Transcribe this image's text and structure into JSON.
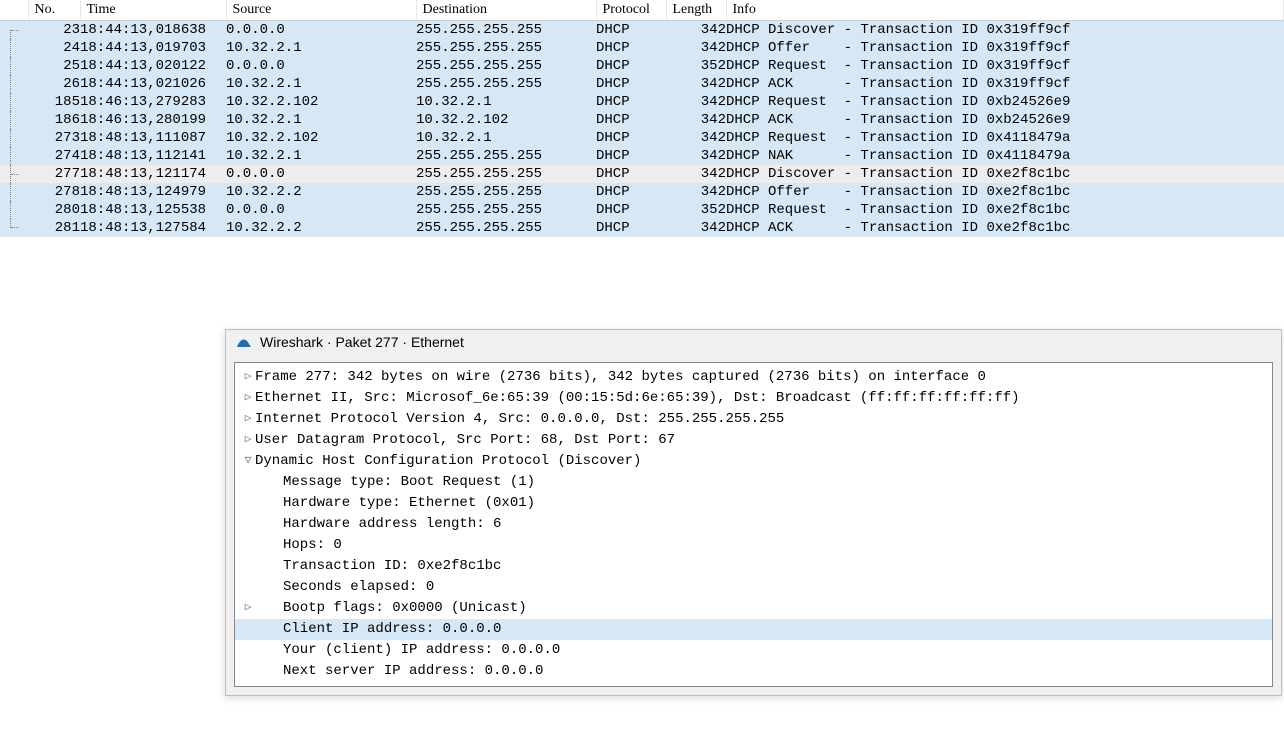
{
  "columns": [
    "No.",
    "Time",
    "Source",
    "Destination",
    "Protocol",
    "Length",
    "Info"
  ],
  "packets": [
    {
      "no": "23",
      "time": "18:44:13,018638",
      "src": "0.0.0.0",
      "dst": "255.255.255.255",
      "proto": "DHCP",
      "len": "342",
      "info": "DHCP Discover - Transaction ID 0x319ff9cf",
      "sel": false,
      "tree": "top"
    },
    {
      "no": "24",
      "time": "18:44:13,019703",
      "src": "10.32.2.1",
      "dst": "255.255.255.255",
      "proto": "DHCP",
      "len": "342",
      "info": "DHCP Offer    - Transaction ID 0x319ff9cf",
      "sel": false,
      "tree": "line"
    },
    {
      "no": "25",
      "time": "18:44:13,020122",
      "src": "0.0.0.0",
      "dst": "255.255.255.255",
      "proto": "DHCP",
      "len": "352",
      "info": "DHCP Request  - Transaction ID 0x319ff9cf",
      "sel": false,
      "tree": "line"
    },
    {
      "no": "26",
      "time": "18:44:13,021026",
      "src": "10.32.2.1",
      "dst": "255.255.255.255",
      "proto": "DHCP",
      "len": "342",
      "info": "DHCP ACK      - Transaction ID 0x319ff9cf",
      "sel": false,
      "tree": "line"
    },
    {
      "no": "185",
      "time": "18:46:13,279283",
      "src": "10.32.2.102",
      "dst": "10.32.2.1",
      "proto": "DHCP",
      "len": "342",
      "info": "DHCP Request  - Transaction ID 0xb24526e9",
      "sel": false,
      "tree": "line"
    },
    {
      "no": "186",
      "time": "18:46:13,280199",
      "src": "10.32.2.1",
      "dst": "10.32.2.102",
      "proto": "DHCP",
      "len": "342",
      "info": "DHCP ACK      - Transaction ID 0xb24526e9",
      "sel": false,
      "tree": "line"
    },
    {
      "no": "273",
      "time": "18:48:13,111087",
      "src": "10.32.2.102",
      "dst": "10.32.2.1",
      "proto": "DHCP",
      "len": "342",
      "info": "DHCP Request  - Transaction ID 0x4118479a",
      "sel": false,
      "tree": "line"
    },
    {
      "no": "274",
      "time": "18:48:13,112141",
      "src": "10.32.2.1",
      "dst": "255.255.255.255",
      "proto": "DHCP",
      "len": "342",
      "info": "DHCP NAK      - Transaction ID 0x4118479a",
      "sel": false,
      "tree": "line"
    },
    {
      "no": "277",
      "time": "18:48:13,121174",
      "src": "0.0.0.0",
      "dst": "255.255.255.255",
      "proto": "DHCP",
      "len": "342",
      "info": "DHCP Discover - Transaction ID 0xe2f8c1bc",
      "sel": true,
      "tree": "mid"
    },
    {
      "no": "278",
      "time": "18:48:13,124979",
      "src": "10.32.2.2",
      "dst": "255.255.255.255",
      "proto": "DHCP",
      "len": "342",
      "info": "DHCP Offer    - Transaction ID 0xe2f8c1bc",
      "sel": false,
      "tree": "line"
    },
    {
      "no": "280",
      "time": "18:48:13,125538",
      "src": "0.0.0.0",
      "dst": "255.255.255.255",
      "proto": "DHCP",
      "len": "352",
      "info": "DHCP Request  - Transaction ID 0xe2f8c1bc",
      "sel": false,
      "tree": "line"
    },
    {
      "no": "281",
      "time": "18:48:13,127584",
      "src": "10.32.2.2",
      "dst": "255.255.255.255",
      "proto": "DHCP",
      "len": "342",
      "info": "DHCP ACK      - Transaction ID 0xe2f8c1bc",
      "sel": false,
      "tree": "end"
    }
  ],
  "detail": {
    "title": "Wireshark · Paket 277 · Ethernet",
    "lines": [
      {
        "indent": 0,
        "caret": "r",
        "text": "Frame 277: 342 bytes on wire (2736 bits), 342 bytes captured (2736 bits) on interface 0",
        "hl": false
      },
      {
        "indent": 0,
        "caret": "r",
        "text": "Ethernet II, Src: Microsof_6e:65:39 (00:15:5d:6e:65:39), Dst: Broadcast (ff:ff:ff:ff:ff:ff)",
        "hl": false
      },
      {
        "indent": 0,
        "caret": "r",
        "text": "Internet Protocol Version 4, Src: 0.0.0.0, Dst: 255.255.255.255",
        "hl": false
      },
      {
        "indent": 0,
        "caret": "r",
        "text": "User Datagram Protocol, Src Port: 68, Dst Port: 67",
        "hl": false
      },
      {
        "indent": 0,
        "caret": "d",
        "text": "Dynamic Host Configuration Protocol (Discover)",
        "hl": false
      },
      {
        "indent": 1,
        "caret": "",
        "text": "Message type: Boot Request (1)",
        "hl": false
      },
      {
        "indent": 1,
        "caret": "",
        "text": "Hardware type: Ethernet (0x01)",
        "hl": false
      },
      {
        "indent": 1,
        "caret": "",
        "text": "Hardware address length: 6",
        "hl": false
      },
      {
        "indent": 1,
        "caret": "",
        "text": "Hops: 0",
        "hl": false
      },
      {
        "indent": 1,
        "caret": "",
        "text": "Transaction ID: 0xe2f8c1bc",
        "hl": false
      },
      {
        "indent": 1,
        "caret": "",
        "text": "Seconds elapsed: 0",
        "hl": false
      },
      {
        "indent": 1,
        "caret": "r",
        "text": "Bootp flags: 0x0000 (Unicast)",
        "hl": false
      },
      {
        "indent": 1,
        "caret": "",
        "text": "Client IP address: 0.0.0.0",
        "hl": true
      },
      {
        "indent": 1,
        "caret": "",
        "text": "Your (client) IP address: 0.0.0.0",
        "hl": false
      },
      {
        "indent": 1,
        "caret": "",
        "text": "Next server IP address: 0.0.0.0",
        "hl": false
      }
    ]
  }
}
